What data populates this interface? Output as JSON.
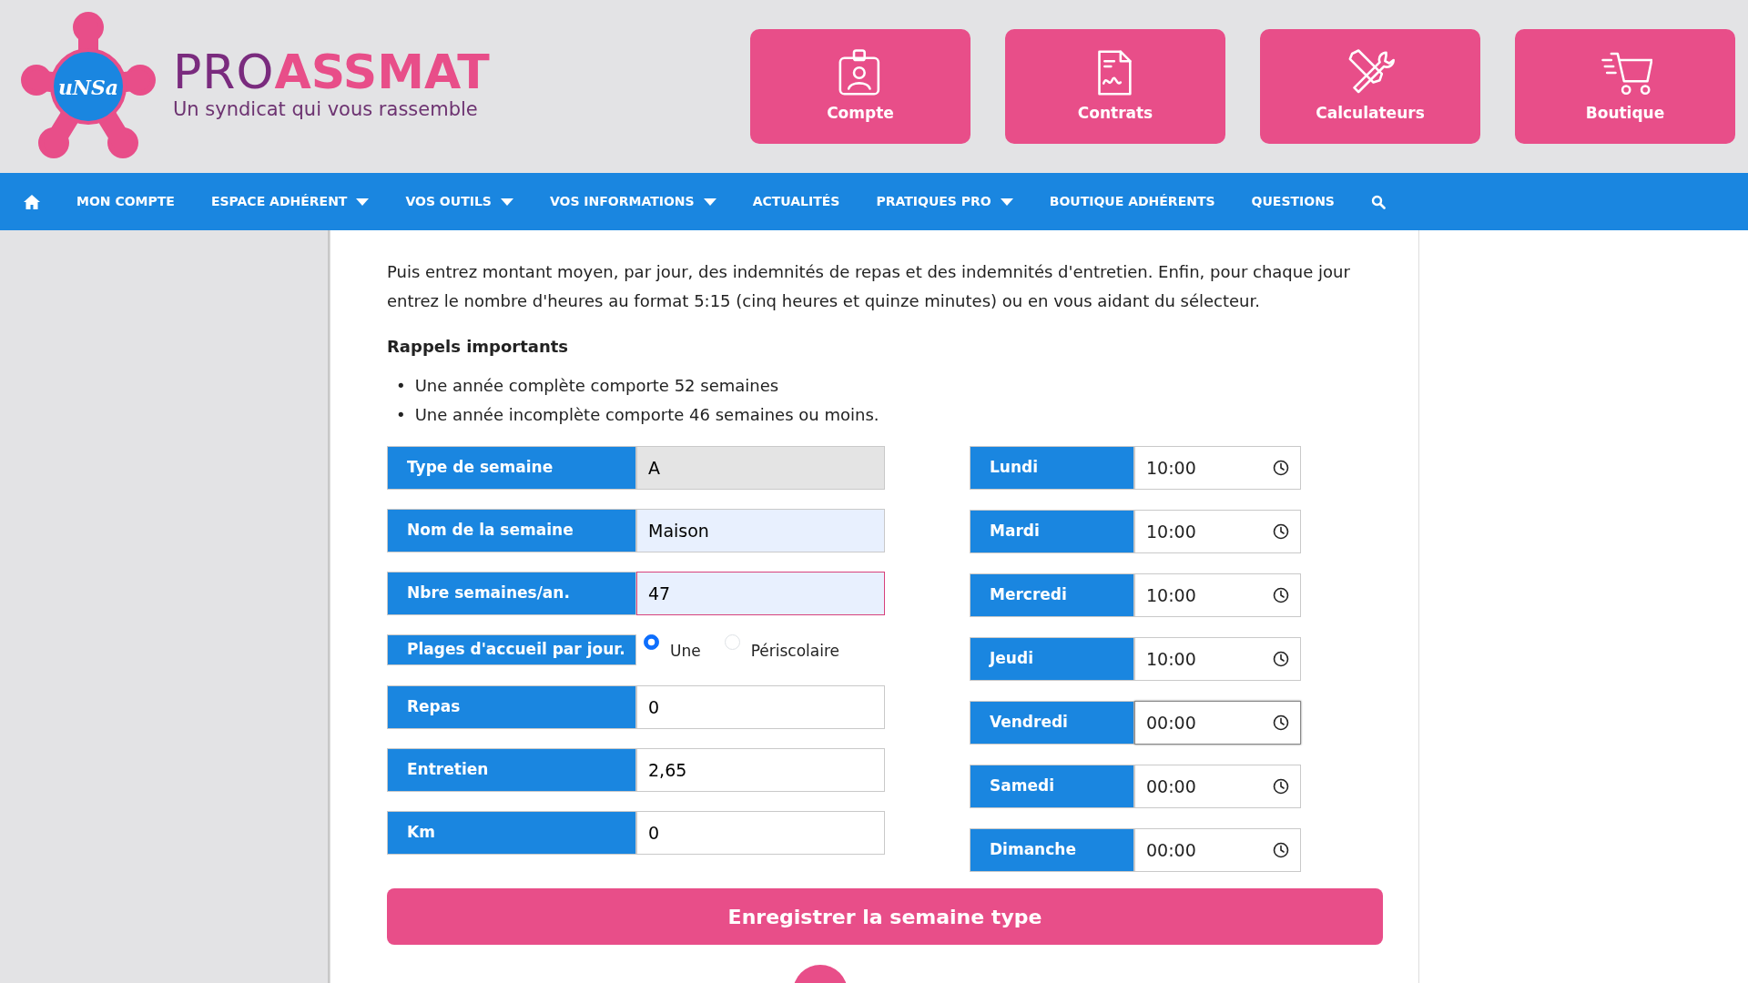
{
  "header": {
    "logo": {
      "badge": "uNSa",
      "brand_first": "PRO",
      "brand_second": "ASSMAT",
      "tagline": "Un syndicat qui vous rassemble"
    },
    "shortcuts": [
      {
        "kind": "account",
        "label": "Compte"
      },
      {
        "kind": "contract",
        "label": "Contrats"
      },
      {
        "kind": "tools",
        "label": "Calculateurs"
      },
      {
        "kind": "cart",
        "label": "Boutique"
      }
    ]
  },
  "nav": {
    "items": [
      {
        "kind": "home"
      },
      {
        "kind": "link",
        "label": "MON COMPTE",
        "dropdown": false
      },
      {
        "kind": "link",
        "label": "ESPACE ADHÉRENT",
        "dropdown": true
      },
      {
        "kind": "link",
        "label": "VOS OUTILS",
        "dropdown": true
      },
      {
        "kind": "link",
        "label": "VOS INFORMATIONS",
        "dropdown": true
      },
      {
        "kind": "link",
        "label": "ACTUALITÉS",
        "dropdown": false
      },
      {
        "kind": "link",
        "label": "PRATIQUES PRO",
        "dropdown": true
      },
      {
        "kind": "link",
        "label": "BOUTIQUE ADHÉRENTS",
        "dropdown": false
      },
      {
        "kind": "link",
        "label": "QUESTIONS",
        "dropdown": false
      },
      {
        "kind": "search"
      }
    ]
  },
  "content": {
    "intro": "Puis entrez montant moyen, par jour, des indemnités de repas et des indemnités d'entretien. Enfin, pour chaque jour entrez le nombre d'heures au format 5:15 (cinq heures et quinze minutes) ou en vous aidant du sélecteur.",
    "reminders_title": "Rappels importants",
    "reminders": [
      {
        "bullet": "•",
        "text": "Une année complète comporte 52 semaines"
      },
      {
        "bullet": "•",
        "text": "Une année incomplète comporte 46 semaines ou moins."
      }
    ],
    "fields": [
      {
        "kind": "input",
        "label": "Type de semaine",
        "value": "A",
        "readonly": true,
        "highlighted": false,
        "invalid": false
      },
      {
        "kind": "input",
        "label": "Nom de la semaine",
        "value": "Maison",
        "readonly": false,
        "highlighted": true,
        "invalid": false
      },
      {
        "kind": "input",
        "label": "Nbre semaines/an.",
        "value": "47",
        "readonly": false,
        "highlighted": true,
        "invalid": true
      },
      {
        "kind": "radio",
        "label": "Plages d'accueil par jour.",
        "options": [
          {
            "label": "Une",
            "selected": true
          },
          {
            "label": "Périscolaire",
            "selected": false
          }
        ]
      },
      {
        "kind": "input",
        "label": "Repas",
        "value": "0",
        "readonly": false,
        "highlighted": false,
        "invalid": false
      },
      {
        "kind": "input",
        "label": "Entretien",
        "value": "2,65",
        "readonly": false,
        "highlighted": false,
        "invalid": false
      },
      {
        "kind": "input",
        "label": "Km",
        "value": "0",
        "readonly": false,
        "highlighted": false,
        "invalid": false
      }
    ],
    "days": [
      {
        "label": "Lundi",
        "value": "10:00",
        "focused": false
      },
      {
        "label": "Mardi",
        "value": "10:00",
        "focused": false
      },
      {
        "label": "Mercredi",
        "value": "10:00",
        "focused": false
      },
      {
        "label": "Jeudi",
        "value": "10:00",
        "focused": false
      },
      {
        "label": "Vendredi",
        "value": "00:00",
        "focused": true
      },
      {
        "label": "Samedi",
        "value": "00:00",
        "focused": false
      },
      {
        "label": "Dimanche",
        "value": "00:00",
        "focused": false
      }
    ],
    "submit": "Enregistrer la semaine type"
  }
}
